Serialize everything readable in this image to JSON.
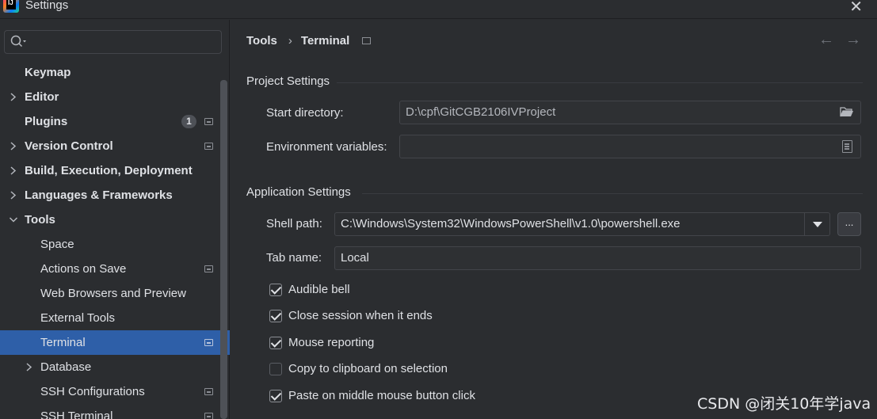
{
  "window": {
    "title": "Settings"
  },
  "search": {
    "placeholder": "",
    "value": ""
  },
  "sidebar": {
    "items": [
      {
        "label": "Keymap"
      },
      {
        "label": "Editor"
      },
      {
        "label": "Plugins",
        "badge": "1"
      },
      {
        "label": "Version Control"
      },
      {
        "label": "Build, Execution, Deployment"
      },
      {
        "label": "Languages & Frameworks"
      },
      {
        "label": "Tools"
      },
      {
        "label": "Space"
      },
      {
        "label": "Actions on Save"
      },
      {
        "label": "Web Browsers and Preview"
      },
      {
        "label": "External Tools"
      },
      {
        "label": "Terminal"
      },
      {
        "label": "Database"
      },
      {
        "label": "SSH Configurations"
      },
      {
        "label": "SSH Terminal"
      }
    ]
  },
  "breadcrumb": {
    "parent": "Tools",
    "separator": "›",
    "current": "Terminal"
  },
  "nav": {
    "back": "←",
    "forward": "→"
  },
  "project_settings": {
    "title": "Project Settings",
    "start_directory_label": "Start directory:",
    "start_directory_value": "D:\\cpf\\GitCGB2106IVProject",
    "env_vars_label": "Environment variables:",
    "env_vars_value": ""
  },
  "application_settings": {
    "title": "Application Settings",
    "shell_path_label": "Shell path:",
    "shell_path_value": "C:\\Windows\\System32\\WindowsPowerShell\\v1.0\\powershell.exe",
    "browse_label": "...",
    "tab_name_label": "Tab name:",
    "tab_name_value": "Local"
  },
  "checkboxes": [
    {
      "label": "Audible bell",
      "checked": true
    },
    {
      "label": "Close session when it ends",
      "checked": true
    },
    {
      "label": "Mouse reporting",
      "checked": true
    },
    {
      "label": "Copy to clipboard on selection",
      "checked": false
    },
    {
      "label": "Paste on middle mouse button click",
      "checked": true
    }
  ],
  "watermark": "CSDN @闭关10年学java",
  "colors": {
    "background": "#2b2d30",
    "selection": "#2e5fa8",
    "text": "#dfe1e5"
  }
}
